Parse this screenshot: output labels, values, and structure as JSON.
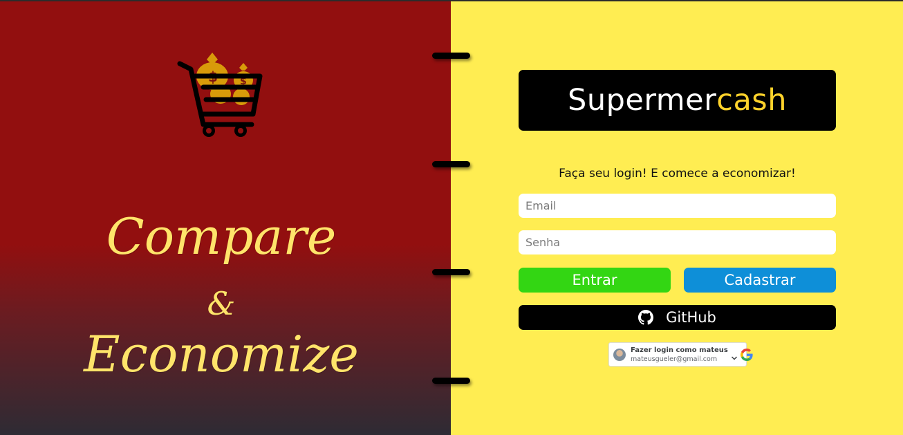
{
  "hero": {
    "word1": "Compare",
    "ampersand": "&",
    "word2": "Economize",
    "icon": "shopping-cart-money-bags-icon"
  },
  "brand": {
    "part1": "Supermer",
    "part2": "cash",
    "color_part1": "#ffffff",
    "color_part2": "#ffd32b"
  },
  "login": {
    "tagline": "Faça seu login! E comece a economizar!",
    "email_placeholder": "Email",
    "password_placeholder": "Senha",
    "enter_label": "Entrar",
    "register_label": "Cadastrar",
    "github_label": "GitHub",
    "github_icon": "github-icon"
  },
  "google_signin": {
    "title": "Fazer login como mateus",
    "email": "mateusgueler@gmail.com",
    "icon": "google-g-icon"
  },
  "colors": {
    "left_panel": "#920f0f",
    "left_panel_bottom": "#2e2b34",
    "right_panel": "#ffed52",
    "enter_button": "#33d613",
    "register_button": "#0e8fd8",
    "github_button": "#000000",
    "slogan_text": "#ffe46a"
  }
}
